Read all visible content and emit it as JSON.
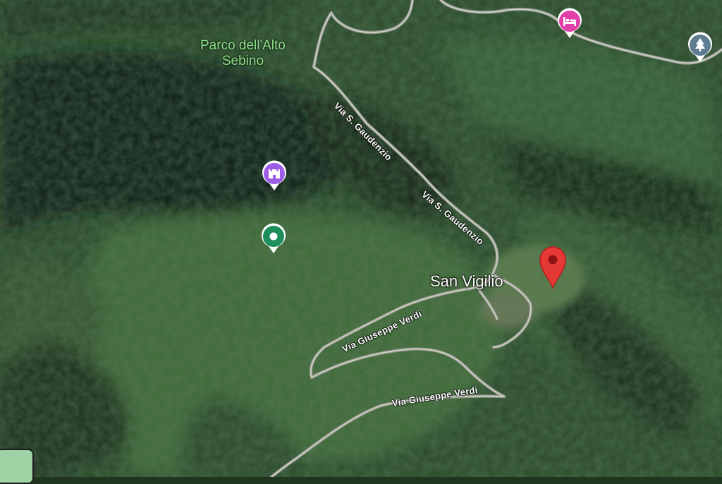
{
  "map": {
    "view": "satellite",
    "place_labels": {
      "park": "Parco dell'Alto Sebino",
      "park_line1": "Parco dell'Alto",
      "park_line2": "Sebino",
      "town": "San Vigilio"
    },
    "road_labels": {
      "road1": "Via S. Gaudenzio",
      "road2": "Via S. Gaudenzio",
      "road3": "Via Giuseppe Verdi",
      "road4": "Via Giuseppe Verdi"
    },
    "markers": [
      {
        "name": "hotel-marker",
        "icon": "bed-icon",
        "color": "#e040a8"
      },
      {
        "name": "park-marker",
        "icon": "tree-icon",
        "color": "#5f7d90"
      },
      {
        "name": "castle-marker",
        "icon": "castle-icon",
        "color": "#9c5ce6"
      },
      {
        "name": "place-marker",
        "icon": "dot-icon",
        "color": "#1e8e5a"
      },
      {
        "name": "selected-location-pin",
        "icon": "pin-icon",
        "color": "#e53935"
      }
    ]
  }
}
